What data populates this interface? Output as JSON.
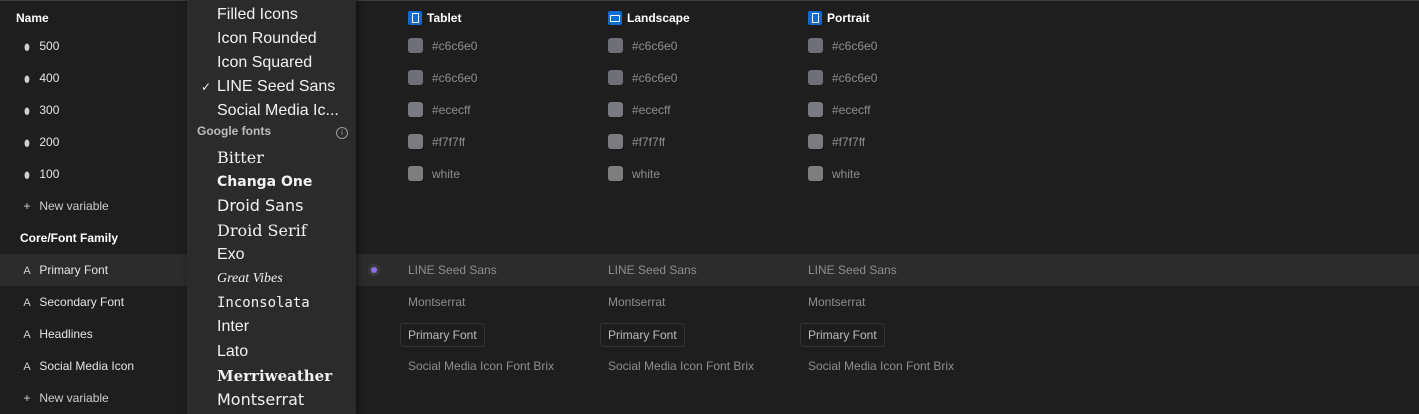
{
  "header": {
    "name": "Name",
    "modes": [
      {
        "label": "Tablet",
        "icon": "tablet-icon"
      },
      {
        "label": "Landscape",
        "icon": "landscape-icon"
      },
      {
        "label": "Portrait",
        "icon": "portrait-icon"
      }
    ]
  },
  "color_rows": [
    {
      "name": "500",
      "icon": "drop-icon",
      "value": "#c6c6e0",
      "swatch": "#6f6f79"
    },
    {
      "name": "400",
      "icon": "drop-icon",
      "value": "#c6c6e0",
      "swatch": "#6f6f79"
    },
    {
      "name": "300",
      "icon": "drop-icon",
      "value": "#ececff",
      "swatch": "#7a7a82"
    },
    {
      "name": "200",
      "icon": "drop-icon",
      "value": "#f7f7ff",
      "swatch": "#7c7c80"
    },
    {
      "name": "100",
      "icon": "drop-icon",
      "value": "white",
      "swatch": "#7e7e7e"
    }
  ],
  "new_variable_label": "New variable",
  "group_label": "Core/Font Family",
  "font_rows": [
    {
      "name": "Primary Font",
      "value": "LINE Seed Sans",
      "alias": false
    },
    {
      "name": "Secondary Font",
      "value": "Montserrat",
      "alias": false
    },
    {
      "name": "Headlines",
      "value": "Primary Font",
      "alias": true
    },
    {
      "name": "Social Media Icon",
      "value": "Social Media Icon Font Brix",
      "alias": false
    }
  ],
  "menu": {
    "items_top": [
      "Filled Icons",
      "Icon Rounded",
      "Icon Squared",
      "LINE Seed Sans",
      "Social Media Ic..."
    ],
    "selected": "LINE Seed Sans",
    "section_label": "Google fonts",
    "google_fonts": [
      "Bitter",
      "Changa One",
      "Droid Sans",
      "Droid Serif",
      "Exo",
      "Great Vibes",
      "Inconsolata",
      "Inter",
      "Lato",
      "Merriweather",
      "Montserrat"
    ]
  },
  "colors": {
    "accent": "#8c6cf0",
    "mode_icon": "#0d6bd1"
  }
}
